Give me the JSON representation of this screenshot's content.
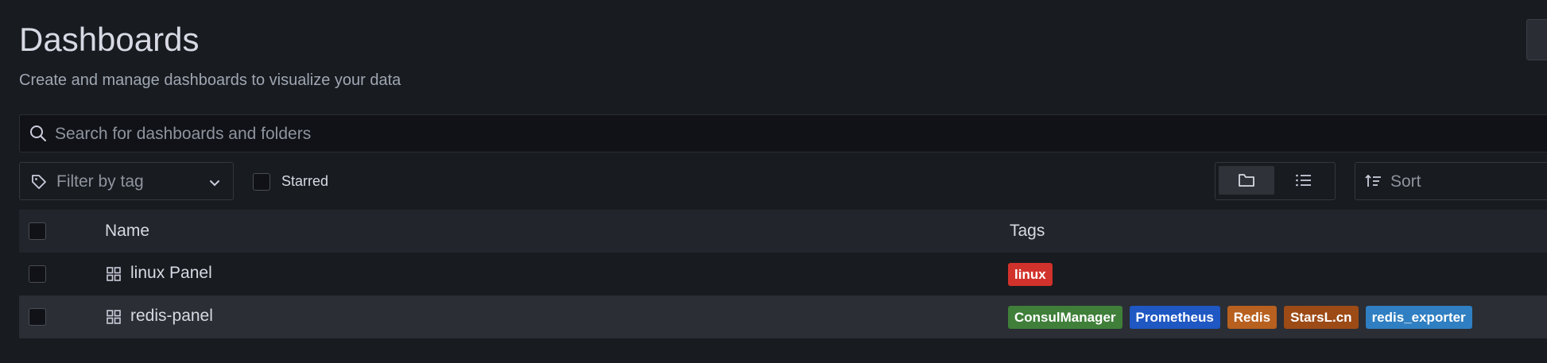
{
  "page": {
    "title": "Dashboards",
    "subtitle": "Create and manage dashboards to visualize your data"
  },
  "search": {
    "placeholder": "Search for dashboards and folders"
  },
  "filter": {
    "label": "Filter by tag"
  },
  "starred": {
    "label": "Starred",
    "checked": false
  },
  "view_toggle": {
    "options": [
      "folder-view",
      "list-view"
    ],
    "active": "folder-view"
  },
  "sort": {
    "label": "Sort"
  },
  "table": {
    "headers": {
      "name": "Name",
      "tags": "Tags"
    },
    "rows": [
      {
        "name": "linux Panel",
        "tags": [
          {
            "label": "linux",
            "color": "#d1322b"
          }
        ]
      },
      {
        "name": "redis-panel",
        "tags": [
          {
            "label": "ConsulManager",
            "color": "#3f7f3a"
          },
          {
            "label": "Prometheus",
            "color": "#1f57c3"
          },
          {
            "label": "Redis",
            "color": "#b8601f"
          },
          {
            "label": "StarsL.cn",
            "color": "#9c4a16"
          },
          {
            "label": "redis_exporter",
            "color": "#2f7fc2"
          }
        ]
      }
    ]
  },
  "colors": {
    "background": "#181b1f",
    "header_row": "#22252b",
    "hover_row": "#2b2e34"
  }
}
